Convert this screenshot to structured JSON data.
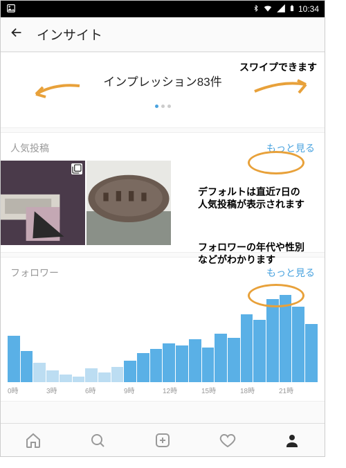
{
  "status": {
    "time": "10:34"
  },
  "header": {
    "title": "インサイト"
  },
  "impressions": {
    "label": "インプレッション83件"
  },
  "popular": {
    "title": "人気投稿",
    "more": "もっと見る"
  },
  "followers": {
    "title": "フォロワー",
    "more": "もっと見る"
  },
  "annotations": {
    "swipe": "スワイプできます",
    "popular_note_l1": "デフォルトは直近7日の",
    "popular_note_l2": "人気投稿が表示されます",
    "follower_note_l1": "フォロワーの年代や性別",
    "follower_note_l2": "などがわかります"
  },
  "chart_data": {
    "type": "bar",
    "title": "",
    "xlabel": "",
    "ylabel": "",
    "ylim": [
      0,
      100
    ],
    "categories": [
      "0時",
      "",
      "",
      "3時",
      "",
      "",
      "6時",
      "",
      "",
      "9時",
      "",
      "",
      "12時",
      "",
      "",
      "15時",
      "",
      "",
      "18時",
      "",
      "",
      "21時",
      "",
      ""
    ],
    "values": [
      48,
      32,
      20,
      12,
      8,
      6,
      14,
      10,
      16,
      22,
      30,
      34,
      40,
      38,
      44,
      36,
      50,
      46,
      70,
      64,
      86,
      90,
      78,
      60
    ],
    "light": [
      false,
      false,
      true,
      true,
      true,
      true,
      true,
      true,
      true,
      false,
      false,
      false,
      false,
      false,
      false,
      false,
      false,
      false,
      false,
      false,
      false,
      false,
      false,
      false
    ],
    "xticks": [
      "0時",
      "3時",
      "6時",
      "9時",
      "12時",
      "15時",
      "18時",
      "21時"
    ]
  }
}
